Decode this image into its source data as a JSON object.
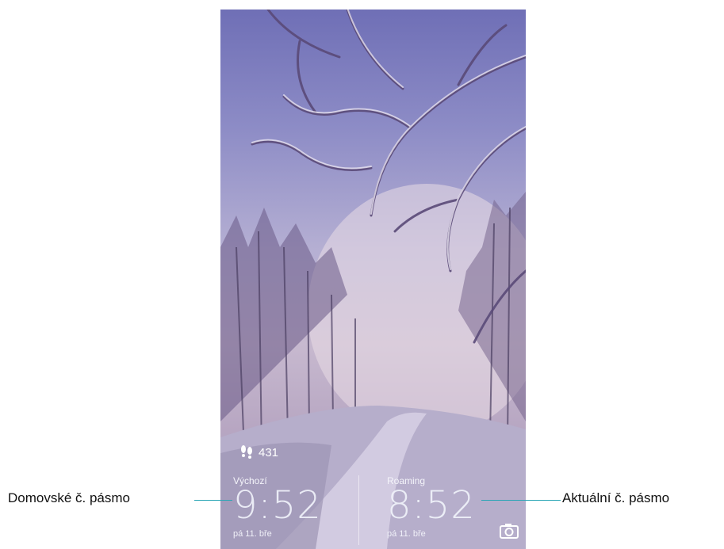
{
  "lockscreen": {
    "step_count": "431",
    "home_clock": {
      "label": "Výchozí",
      "time": "9:52",
      "date": "pá 11. bře"
    },
    "roaming_clock": {
      "label": "Roaming",
      "time": "8:52",
      "date": "pá 11. bře"
    }
  },
  "callouts": {
    "left": "Domovské č. pásmo",
    "right": "Aktuální č. pásmo"
  },
  "icons": {
    "steps": "footsteps-icon",
    "camera": "camera-icon"
  },
  "colors": {
    "callout_line": "#2aa5b5"
  }
}
